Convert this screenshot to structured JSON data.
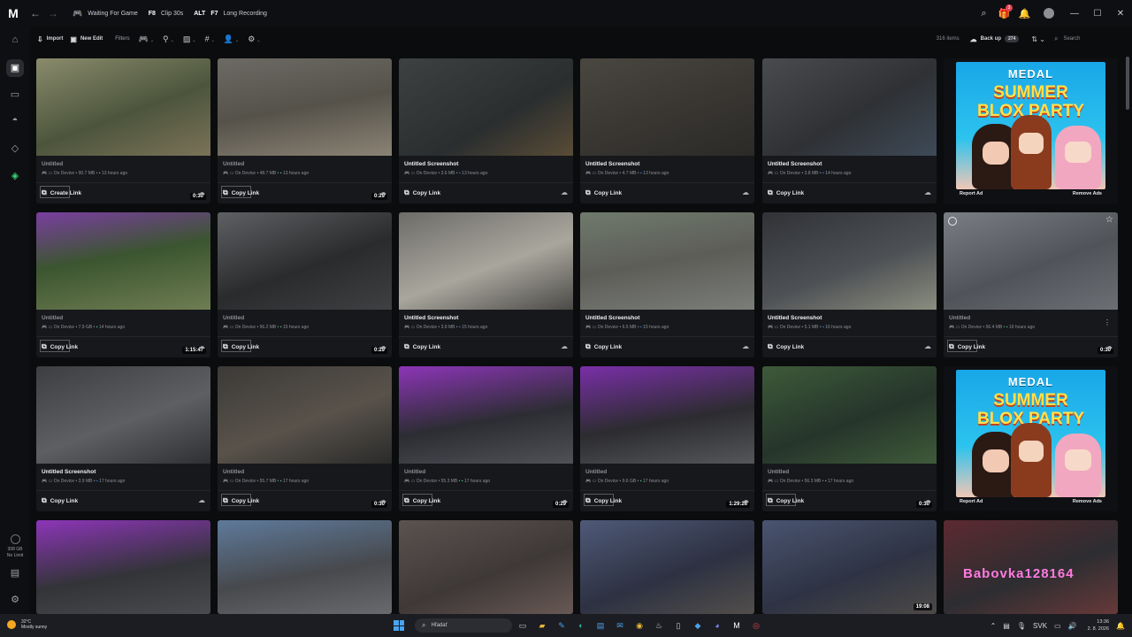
{
  "titlebar": {
    "hotkeys": [
      {
        "key": "",
        "label": "Waiting For Game",
        "icon": "controller-icon"
      },
      {
        "key": "F8",
        "label": "Clip 30s",
        "icon": ""
      },
      {
        "key": "ALT",
        "label": "",
        "icon": ""
      },
      {
        "key": "F7",
        "label": "Long Recording",
        "icon": ""
      }
    ],
    "notification_count": "3"
  },
  "toolbar": {
    "import_label": "Import",
    "new_edit_label": "New Edit",
    "filters_label": "Filters",
    "items_count": "316 items",
    "backup_label": "Back up",
    "backup_count": "274",
    "search_placeholder": "Search"
  },
  "sidebar": {
    "storage_text": "308 GB",
    "storage_sub": "No Limit"
  },
  "common": {
    "on_device": "On Device",
    "copy_link": "Copy Link",
    "create_link": "Create Link",
    "report_ad": "Report Ad",
    "remove_ads": "Remove Ads",
    "ad_brand": "MEDAL",
    "ad_line1": "SUMMER",
    "ad_line2": "BLOX PARTY",
    "watermark": "Babovka128164"
  },
  "cards": [
    {
      "title": "Untitled",
      "size": "90.7 MB",
      "time": "13 hours ago",
      "duration": "0:30",
      "link": "Create Link",
      "time_color": "green"
    },
    {
      "title": "Untitled",
      "size": "48.7 MB",
      "time": "13 hours ago",
      "duration": "0:29",
      "link": "Copy Link",
      "time_color": "green"
    },
    {
      "title": "Untitled Screenshot",
      "size": "3.6 MB",
      "time": "13 hours ago",
      "duration": "",
      "link": "Copy Link",
      "time_color": "blue"
    },
    {
      "title": "Untitled Screenshot",
      "size": "4.7 MB",
      "time": "13 hours ago",
      "duration": "",
      "link": "Copy Link",
      "time_color": "blue"
    },
    {
      "title": "Untitled Screenshot",
      "size": "3.8 MB",
      "time": "14 hours ago",
      "duration": "",
      "link": "Copy Link",
      "time_color": "blue"
    },
    {
      "title": "Untitled",
      "size": "7.9 GB",
      "time": "14 hours ago",
      "duration": "1:15:47",
      "link": "Copy Link",
      "time_color": "green"
    },
    {
      "title": "Untitled",
      "size": "56.2 MB",
      "time": "15 hours ago",
      "duration": "0:29",
      "link": "Copy Link",
      "time_color": "green"
    },
    {
      "title": "Untitled Screenshot",
      "size": "3.9 MB",
      "time": "15 hours ago",
      "duration": "",
      "link": "Copy Link",
      "time_color": "blue"
    },
    {
      "title": "Untitled Screenshot",
      "size": "6.5 MB",
      "time": "15 hours ago",
      "duration": "",
      "link": "Copy Link",
      "time_color": "blue"
    },
    {
      "title": "Untitled Screenshot",
      "size": "5.1 MB",
      "time": "16 hours ago",
      "duration": "",
      "link": "Copy Link",
      "time_color": "blue"
    },
    {
      "title": "Untitled",
      "size": "56.4 MB",
      "time": "16 hours ago",
      "duration": "0:30",
      "link": "Copy Link",
      "time_color": "green"
    },
    {
      "title": "Untitled Screenshot",
      "size": "3.9 MB",
      "time": "17 hours ago",
      "duration": "",
      "link": "Copy Link",
      "time_color": "blue"
    },
    {
      "title": "Untitled",
      "size": "55.7 MB",
      "time": "17 hours ago",
      "duration": "0:30",
      "link": "Copy Link",
      "time_color": "green"
    },
    {
      "title": "Untitled",
      "size": "55.3 MB",
      "time": "17 hours ago",
      "duration": "0:29",
      "link": "Copy Link",
      "time_color": "green"
    },
    {
      "title": "Untitled",
      "size": "9.6 GB",
      "time": "17 hours ago",
      "duration": "1:29:26",
      "link": "Copy Link",
      "time_color": "green"
    },
    {
      "title": "Untitled",
      "size": "56.3 MB",
      "time": "17 hours ago",
      "duration": "0:30",
      "link": "Copy Link",
      "time_color": "green"
    }
  ],
  "bottom_row_durations": [
    "",
    "",
    "",
    "",
    "19:08",
    ""
  ],
  "taskbar": {
    "temp": "32°C",
    "weather": "Mostly sunny",
    "search": "Hľadať",
    "lang": "SVK",
    "time": "13:36",
    "date": "2. 8. 2026"
  }
}
